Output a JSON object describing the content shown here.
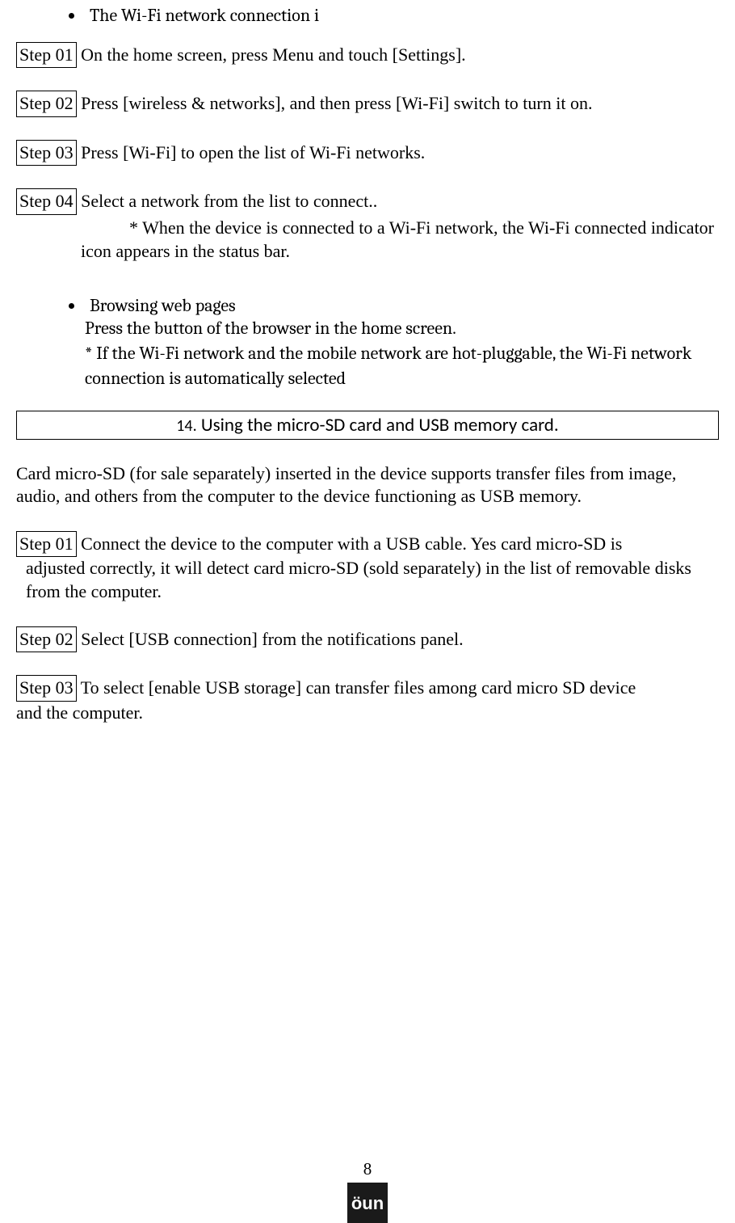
{
  "wifi": {
    "bullet_heading": "The Wi-Fi network connection i",
    "steps": [
      {
        "label": "Step 01",
        "text": " On the home screen, press Menu and touch [Settings]."
      },
      {
        "label": "Step 02",
        "text": " Press [wireless & networks], and then press [Wi-Fi] switch to turn it on."
      },
      {
        "label": "Step 03",
        "text": " Press [Wi-Fi] to open the list of Wi-Fi networks."
      },
      {
        "label": "Step 04",
        "text": " Select a network from the list to connect.."
      }
    ],
    "step4_note": "* When the device is connected to a Wi-Fi network, the Wi-Fi connected indicator icon appears in the status bar."
  },
  "browsing": {
    "heading": "Browsing web pages",
    "line1": "Press the button of the browser in the home screen.",
    "line2": "* If the Wi-Fi network and the mobile network are hot-pluggable, the Wi-Fi network connection is automatically selected"
  },
  "section14": {
    "number": "14.",
    "title": " Using the micro-SD card and USB memory card.",
    "intro": "Card micro-SD (for sale separately) inserted in the device supports transfer files from image, audio, and others from the computer to the device functioning as USB memory.",
    "steps": [
      {
        "label": "Step 01",
        "text_first": " Connect the device to the computer with a USB cable. Yes card micro-SD is",
        "text_cont": "adjusted correctly, it will detect card micro-SD (sold separately) in the list of removable disks from the computer."
      },
      {
        "label": "Step 02",
        "text_first": " Select [USB connection] from the notifications panel.",
        "text_cont": ""
      },
      {
        "label": "Step 03",
        "text_first": " To select [enable USB storage] can transfer files among card micro SD device",
        "text_cont_noindent": "and the computer."
      }
    ]
  },
  "page_number": "8"
}
